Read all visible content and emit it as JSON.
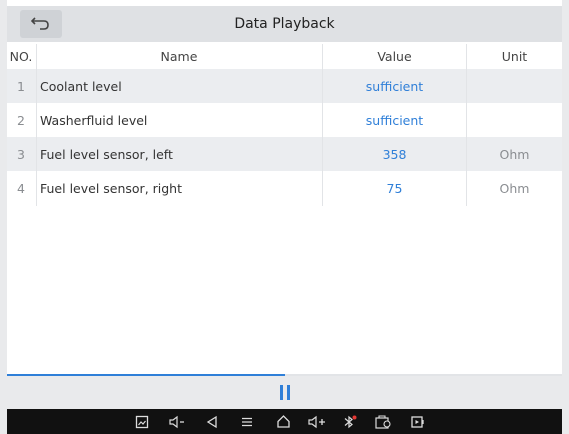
{
  "header": {
    "title": "Data Playback"
  },
  "columns": {
    "no": "NO.",
    "name": "Name",
    "value": "Value",
    "unit": "Unit"
  },
  "rows": [
    {
      "no": "1",
      "name": "Coolant level",
      "value": "sufficient",
      "unit": ""
    },
    {
      "no": "2",
      "name": "Washerfluid level",
      "value": "sufficient",
      "unit": ""
    },
    {
      "no": "3",
      "name": "Fuel level sensor, left",
      "value": "358",
      "unit": "Ohm"
    },
    {
      "no": "4",
      "name": "Fuel level sensor, right",
      "value": "75",
      "unit": "Ohm"
    }
  ],
  "playback": {
    "progress_fraction": 0.5
  },
  "system_bar": {
    "icons": [
      "screenshot-icon",
      "volume-down-icon",
      "back-icon",
      "menu-icon",
      "home-icon",
      "volume-up-icon",
      "bluetooth-icon",
      "vci-icon",
      "screen-record-icon"
    ]
  },
  "colors": {
    "accent": "#2f7fd8",
    "header_bg": "#dfe1e4",
    "row_shade": "#ebedf0",
    "system_bar": "#111111"
  }
}
